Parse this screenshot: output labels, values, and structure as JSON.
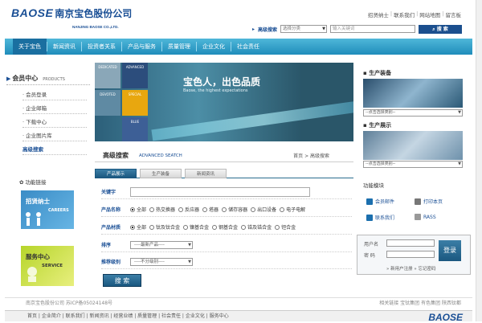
{
  "header": {
    "logo_en": "BAOSE",
    "logo_cn": "南京宝色股份公司",
    "logo_sub": "NANJING BAOSE CO.,LTD.",
    "links": [
      "招贤纳士",
      "联系我们",
      "网站地图",
      "留言板"
    ],
    "search": {
      "label": "高级搜索",
      "category": "选择分类",
      "placeholder": "输入关键词",
      "button": "搜 索"
    }
  },
  "nav": {
    "items": [
      "关于宝色",
      "新闻资讯",
      "投资者关系",
      "产品与服务",
      "质量管理",
      "企业文化",
      "社会责任"
    ]
  },
  "left": {
    "member_title": "会员中心",
    "member_en": "PRODUCTS",
    "menu": [
      "会员登录",
      "企业邮箱",
      "下载中心",
      "企业图片库",
      "高级搜索"
    ],
    "feature": "功能链接",
    "careers_cn": "招贤纳士",
    "careers_en": "CAREERS",
    "service_cn": "服务中心",
    "service_en": "SERVICE"
  },
  "banner": {
    "slogan": "宝色人，出色品质",
    "slogan_en": "Baose, the highest expectations",
    "squares": [
      "ADVANCED",
      "SPECIAL",
      "BLUE",
      "DEDICATED",
      "DEVOTED"
    ]
  },
  "search_panel": {
    "title": "高级搜索",
    "title_en": "ADVANCED SEATCH",
    "crumb": "首页 > 高级搜索",
    "tabs": [
      "产品展示",
      "生产装备",
      "新闻资讯"
    ],
    "keyword": "关键字",
    "pname_label": "产品名称",
    "pname_opts": [
      "全部",
      "热交换器",
      "反应器",
      "塔器",
      "储存容器",
      "出口设备",
      "电子电解"
    ],
    "pmat_label": "产品材质",
    "pmat_opts": [
      "全部",
      "钛及钛合金",
      "镍基合金",
      "钢基合金",
      "锆及锆合金",
      "钽合金"
    ],
    "sort_label": "排序",
    "sort_value": "----最新产品----",
    "level_label": "推荐级别",
    "level_value": "----不分级别----",
    "button": "搜 索"
  },
  "right": {
    "equip_title": "生产装备",
    "equip_select": "--点击选择类别--",
    "show_title": "生产展示",
    "show_select": "--点击选择类别--",
    "func_title": "功能模块",
    "func": [
      "会员邮件",
      "打印本页",
      "联系我们",
      "RASS"
    ],
    "login": {
      "user": "用户名",
      "pass": "密  码",
      "button": "登录",
      "register": "新用户注册",
      "forgot": "忘记密码"
    }
  },
  "footer": {
    "copy": "南京宝色股份公司  苏ICP备05024148号",
    "links_r": "相关链接    宝钛集团    有色集团    陕西钛都",
    "nav": "首页  |  企业简介  |  联系我们  |  新闻资讯  |  经营业绩  |  质量管理  |  社会责任  |  企业文化  |  服务中心",
    "logo": "BAOSE"
  },
  "colors": {
    "brand": "#1a4f95",
    "nav": "#2a9ccc"
  }
}
